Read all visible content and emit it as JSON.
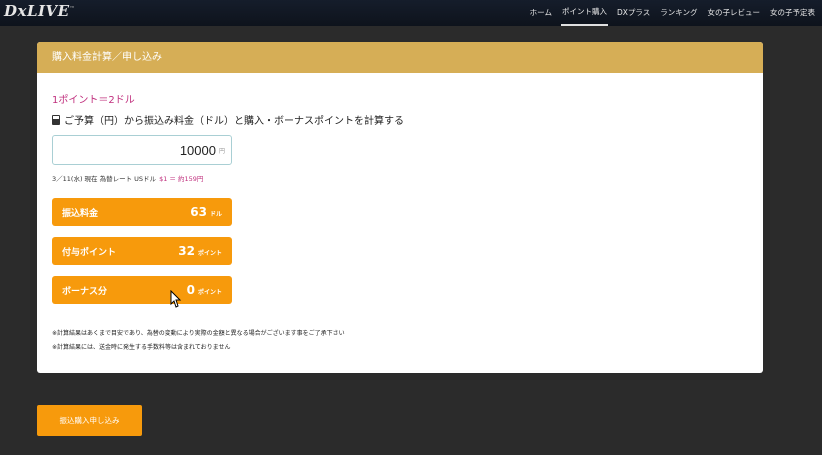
{
  "header": {
    "logo": "DxLIVE",
    "logo_tm": "™",
    "nav": [
      {
        "label": "ホーム",
        "active": false
      },
      {
        "label": "ポイント購入",
        "active": true
      },
      {
        "label": "DXプラス",
        "active": false
      },
      {
        "label": "ランキング",
        "active": false
      },
      {
        "label": "女の子レビュー",
        "active": false
      },
      {
        "label": "女の子予定表",
        "active": false
      }
    ]
  },
  "panel": {
    "title": "購入料金計算／申し込み",
    "rate": "1ポイント＝2ドル",
    "description": "ご予算（円）から振込み料金（ドル）と購入・ボーナスポイントを計算する",
    "budget": {
      "value": "10000",
      "unit": "円"
    },
    "exchange": {
      "text": "3／11(水) 現在 為替レート USドル",
      "highlight": "$1 ＝ 約159円"
    },
    "results": [
      {
        "label": "振込料金",
        "value": "63",
        "unit": "ドル"
      },
      {
        "label": "付与ポイント",
        "value": "32",
        "unit": "ポイント"
      },
      {
        "label": "ボーナス分",
        "value": "0",
        "unit": "ポイント"
      }
    ],
    "notes": [
      "※計算結果はあくまで目安であり、為替の変動により実際の金額と異なる場合がございます事をご了承下さい",
      "※計算結果には、送金時に発生する手数料等は含まれておりません"
    ]
  },
  "submit_label": "振込購入申し込み",
  "colors": {
    "accent_orange": "#f79a0c",
    "header_gold": "#d6ae56",
    "pink": "#c0307e"
  },
  "icons": [
    "calculator-icon",
    "mouse-cursor-icon"
  ]
}
